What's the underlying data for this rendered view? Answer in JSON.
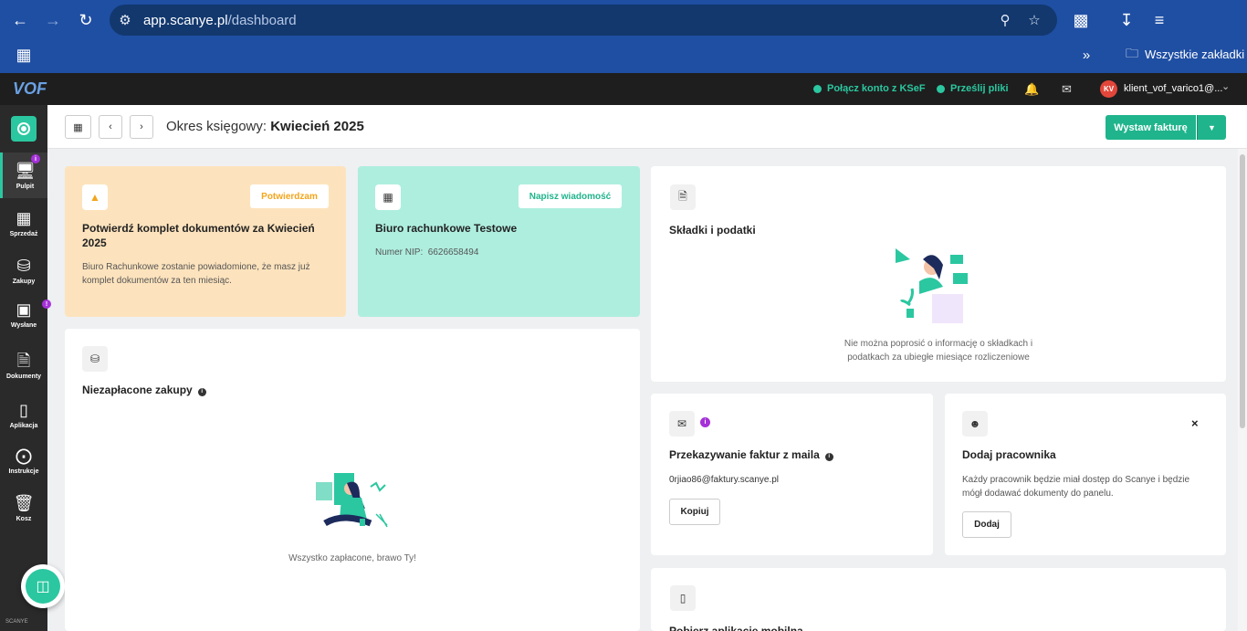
{
  "browser": {
    "url_host": "app.scanye.pl",
    "url_path": "/dashboard",
    "bookmarks_label": "Wszystkie zakładki"
  },
  "header": {
    "logo": "VOF",
    "connect_ksef": "Połącz konto z KSeF",
    "send_files": "Prześlij pliki",
    "avatar_initials": "KV",
    "user_name": "klient_vof_varico1@..."
  },
  "sidebar": {
    "items": [
      {
        "label": "Pulpit",
        "icon": "monitor-icon"
      },
      {
        "label": "Sprzedaż",
        "icon": "register-icon"
      },
      {
        "label": "Zakupy",
        "icon": "basket-icon"
      },
      {
        "label": "Wysłane",
        "icon": "inbox-icon"
      },
      {
        "label": "Dokumenty",
        "icon": "document-icon"
      },
      {
        "label": "Aplikacja",
        "icon": "phone-icon"
      },
      {
        "label": "Instrukcje",
        "icon": "lifebuoy-icon"
      },
      {
        "label": "Kosz",
        "icon": "trash-icon"
      }
    ],
    "brand": "SCANYE"
  },
  "toolbar": {
    "period_label": "Okres księgowy:",
    "period_value": "Kwiecień 2025",
    "issue_invoice": "Wystaw fakturę"
  },
  "confirm_card": {
    "button": "Potwierdzam",
    "title": "Potwierdź komplet dokumentów za Kwiecień 2025",
    "text": "Biuro Rachunkowe zostanie powiadomione, że masz już komplet dokumentów za ten miesiąc."
  },
  "office_card": {
    "button": "Napisz wiadomość",
    "title": "Biuro rachunkowe Testowe",
    "nip_label": "Numer NIP:",
    "nip_value": "6626658494"
  },
  "unpaid_card": {
    "title": "Niezapłacone zakupy",
    "empty": "Wszystko zapłacone, brawo Ty!"
  },
  "taxes_card": {
    "title": "Składki i podatki",
    "empty_line1": "Nie można poprosić o informację o składkach i",
    "empty_line2": "podatkach za ubiegłe miesiące rozliczeniowe"
  },
  "email_card": {
    "title": "Przekazywanie faktur z maila",
    "email": "0rjiao86@faktury.scanye.pl",
    "button": "Kopiuj"
  },
  "employee_card": {
    "title": "Dodaj pracownika",
    "text": "Każdy pracownik będzie miał dostęp do Scanye i będzie mógł dodawać dokumenty do panelu.",
    "button": "Dodaj",
    "close": "×"
  },
  "mobile_card": {
    "title": "Pobierz aplikację mobilną"
  },
  "colors": {
    "accent": "#1fb48c",
    "confirm_bg": "#fde3bd",
    "office_bg": "#aeeedf",
    "badge": "#a531d8"
  }
}
